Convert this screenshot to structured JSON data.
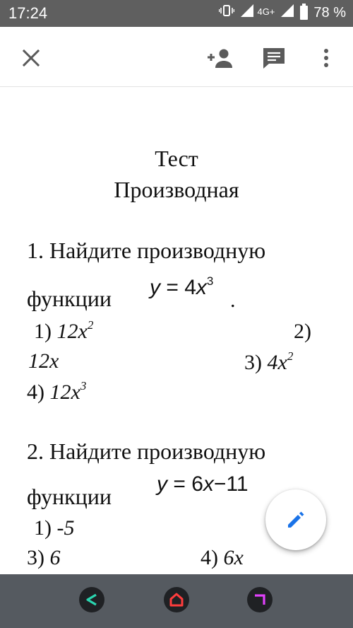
{
  "status_bar": {
    "time": "17:24",
    "network": "4G+",
    "battery": "78 %"
  },
  "toolbar": {
    "icons": [
      "close-icon",
      "add-person-icon",
      "comment-icon",
      "more-vert-icon"
    ]
  },
  "document": {
    "title_line1": "Тест",
    "title_line2": "Производная",
    "q1": {
      "heading": "1. Найдите производную",
      "function_label": "функции",
      "formula_y": "y",
      "formula_eq": " = 4",
      "formula_x": "x",
      "formula_exp": "3",
      "formula_end": ".",
      "opt1_num": "1) ",
      "opt1_base": "12x",
      "opt1_exp": "2",
      "opt2_num": "2)",
      "opt2_val": "12x",
      "opt3_num": "3) ",
      "opt3_base": "4x",
      "opt3_exp": "2",
      "opt4_num": "4) ",
      "opt4_base": "12x",
      "opt4_exp": "3"
    },
    "q2": {
      "heading": "2. Найдите производную",
      "function_label": "функции",
      "formula_y": "y",
      "formula_eq": " = 6",
      "formula_x": "x",
      "formula_rest": "−11",
      "opt1_num": "1) ",
      "opt1_val": "-5",
      "opt3_num": "3) ",
      "opt3_val": "6",
      "opt4_num": "4) ",
      "opt4_val": "6x"
    }
  },
  "fab": {
    "icon": "pencil-icon"
  },
  "colors": {
    "status_bar": "#5f5f5f",
    "nav_bar": "#555a60",
    "fab_icon": "#1a73e8",
    "nav_back": "#2ad6b0",
    "nav_home": "#ff3d3d",
    "nav_recents": "#e040fb"
  }
}
